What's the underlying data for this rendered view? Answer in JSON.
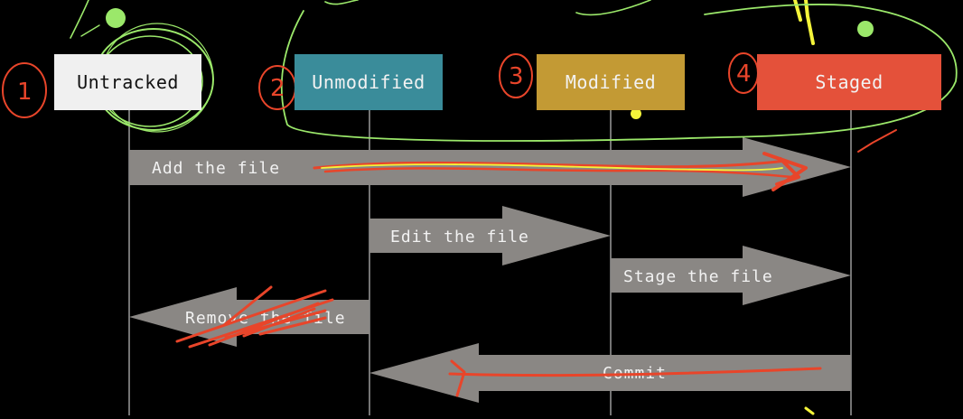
{
  "states": [
    {
      "id": "untracked",
      "label": "Untracked",
      "color": "#f0f0f0",
      "text_color": "#111111",
      "marker": "1"
    },
    {
      "id": "unmodified",
      "label": "Unmodified",
      "color": "#3a8c9a",
      "text_color": "#f2f2f2",
      "marker": "2"
    },
    {
      "id": "modified",
      "label": "Modified",
      "color": "#c39a34",
      "text_color": "#f2f2f2",
      "marker": "3"
    },
    {
      "id": "staged",
      "label": "Staged",
      "color": "#e4513a",
      "text_color": "#f2f2f2",
      "marker": "4"
    }
  ],
  "transitions": [
    {
      "id": "add",
      "label": "Add the file",
      "from": "untracked",
      "to": "staged"
    },
    {
      "id": "edit",
      "label": "Edit the file",
      "from": "unmodified",
      "to": "modified"
    },
    {
      "id": "stage",
      "label": "Stage the file",
      "from": "modified",
      "to": "staged"
    },
    {
      "id": "remove",
      "label": "Remove the file",
      "from": "unmodified",
      "to": "untracked"
    },
    {
      "id": "commit",
      "label": "Commit",
      "from": "staged",
      "to": "unmodified"
    }
  ],
  "colors": {
    "background": "#000000",
    "arrow": "#8a8784",
    "lifeline": "#9a9a9a",
    "annotation_red": "#e8452a",
    "annotation_green": "#9be86a",
    "annotation_yellow": "#f4f43a"
  }
}
